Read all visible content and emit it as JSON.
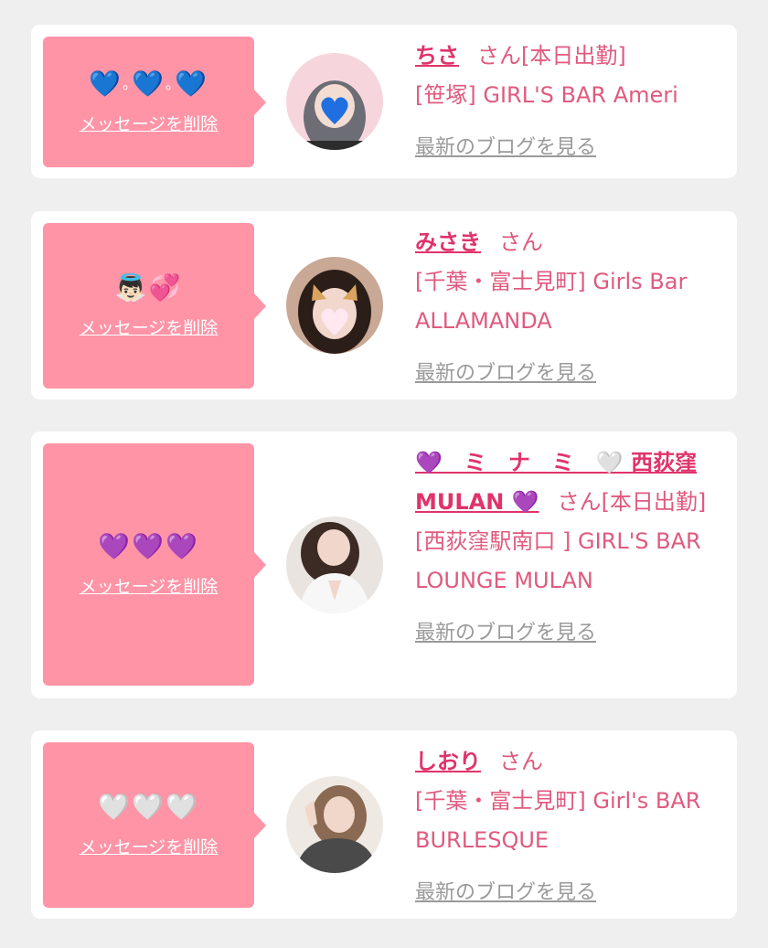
{
  "colors": {
    "background": "#efefef",
    "card": "#ffffff",
    "bubble": "#ff94a6",
    "name_link": "#e0336a",
    "text_pink": "#e05a7e",
    "blog_link": "#9a9a9a"
  },
  "common": {
    "delete_label": "メッセージを削除",
    "blog_label": "最新のブログを見る",
    "honorific": "さん"
  },
  "items": [
    {
      "emoji": [
        "💙",
        "｡",
        "💙",
        "｡",
        "💙"
      ],
      "name": "ちさ",
      "status": "[本日出勤]",
      "shop": "[笹塚] GIRL'S BAR Ameri",
      "avatar_icon": "avatar-blue-heart-sticker"
    },
    {
      "emoji": [
        "👼🏻",
        "💞"
      ],
      "name": "みさき",
      "status": "",
      "shop": "[千葉・富士見町] Girls Bar ALLAMANDA",
      "avatar_icon": "avatar-pink-heart-sticker"
    },
    {
      "emoji": [
        "💜",
        "💜",
        "💜"
      ],
      "name": "💜　ミ　ナ　ミ　🤍 西荻窪 MULAN 💜",
      "status": "[本日出勤]",
      "shop": "[西荻窪駅南口 ] GIRL'S BAR LOUNGE MULAN",
      "avatar_icon": "avatar-photo"
    },
    {
      "emoji": [
        "🤍",
        "🤍",
        "🤍"
      ],
      "name": "しおり",
      "status": "",
      "shop": "[千葉・富士見町] Girl's BAR BURLESQUE",
      "avatar_icon": "avatar-photo"
    }
  ]
}
